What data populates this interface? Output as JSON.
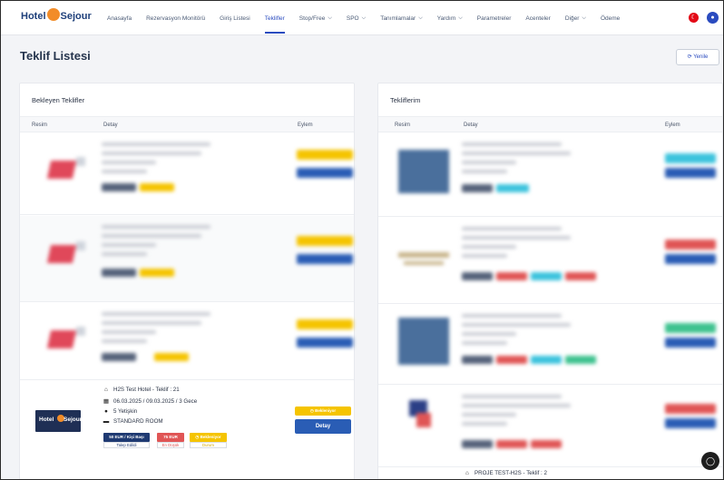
{
  "brand": {
    "logo_left": "Hotel",
    "logo_right": "Sejour"
  },
  "nav": {
    "items": [
      {
        "label": "Anasayfa",
        "caret": false,
        "active": false
      },
      {
        "label": "Rezervasyon Monitörü",
        "caret": false,
        "active": false
      },
      {
        "label": "Giriş Listesi",
        "caret": false,
        "active": false
      },
      {
        "label": "Teklifler",
        "caret": false,
        "active": true
      },
      {
        "label": "Stop/Free",
        "caret": true,
        "active": false
      },
      {
        "label": "SPO",
        "caret": true,
        "active": false
      },
      {
        "label": "Tanımlamalar",
        "caret": true,
        "active": false
      },
      {
        "label": "Yardım",
        "caret": true,
        "active": false
      },
      {
        "label": "Parametreler",
        "caret": false,
        "active": false
      },
      {
        "label": "Acenteler",
        "caret": false,
        "active": false
      },
      {
        "label": "Diğer",
        "caret": true,
        "active": false
      },
      {
        "label": "Ödeme",
        "caret": false,
        "active": false
      }
    ]
  },
  "page": {
    "title": "Teklif Listesi",
    "refresh_label": "Yenile"
  },
  "left_card": {
    "title": "Bekleyen Teklifler",
    "columns": {
      "image": "Resim",
      "detail": "Detay",
      "action": "Eylem"
    },
    "visible_offer": {
      "hotel": "H2S Test Hotel - Teklif : 21",
      "dates": "06.03.2025 / 09.03.2025 / 3 Gece",
      "guests": "5 Yetişkin",
      "room": "STANDARD ROOM",
      "price_tag": "50 EUR / Kişi Başı",
      "price_sub": "Talep Edildi",
      "min_tag": "75 EUR",
      "min_sub": "En Düşük",
      "status_tag": "Bekleniyor",
      "status_sub": "Durum",
      "status_pill": "Bekleniyor",
      "detail_button": "Detay"
    }
  },
  "right_card": {
    "title": "Tekliflerim",
    "columns": {
      "image": "Resim",
      "detail": "Detay",
      "action": "Eylem"
    },
    "partial_row": "PROJE TEST-H2S - Teklif : 2"
  },
  "colors": {
    "accent": "#2a4bbf",
    "yellow": "#f5c400",
    "blue_btn": "#2a5db5",
    "red": "#e05555",
    "cyan": "#3cc3dd",
    "green": "#3ec28f"
  },
  "icons": [
    "home-icon",
    "calendar-icon",
    "person-icon",
    "bed-icon",
    "refresh-icon",
    "chat-icon",
    "user-icon",
    "flag-icon"
  ]
}
